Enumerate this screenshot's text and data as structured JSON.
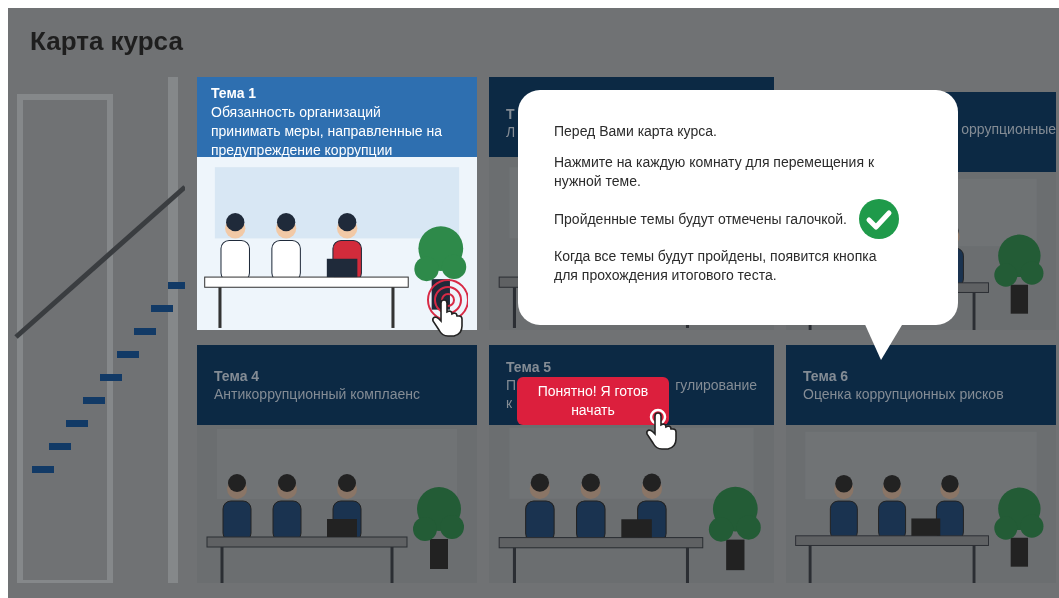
{
  "title": "Карта курса",
  "topics": [
    {
      "label": "Тема 1",
      "title_lines": [
        [
          "Обязанность организаций"
        ],
        [
          "принимать меры, направленные на"
        ],
        [
          "предупреждение коррупции"
        ]
      ],
      "highlighted": true
    },
    {
      "label": "Т",
      "title_lines": [
        [
          "Л"
        ]
      ],
      "highlighted": false
    },
    {
      "title_lines": [
        [
          "оррупционные"
        ]
      ],
      "highlighted": false
    },
    {
      "label": "Тема 4",
      "title_lines": [
        [
          "Антикоррупционный комплаенс"
        ]
      ],
      "highlighted": false
    },
    {
      "label": "Тема 5",
      "title_lines": [
        [
          "П",
          "гулирование"
        ],
        [
          "к"
        ]
      ],
      "highlighted": false
    },
    {
      "label": "Тема 6",
      "title_lines": [
        [
          "Оценка коррупционных рисков"
        ]
      ],
      "highlighted": false
    }
  ],
  "popup": {
    "paragraphs": [
      {
        "text": "Перед Вами карта курса.",
        "check": false
      },
      {
        "text": "Нажмите на каждую комнату для перемещения к нужной теме.",
        "check": false
      },
      {
        "text": "Пройденные темы будут отмечены галочкой.",
        "check": true
      },
      {
        "text": "Когда все темы будут пройдены, появится кнопка для прохождения итогового теста.",
        "check": false
      }
    ]
  },
  "start_button": "Понятно! Я готов начать"
}
